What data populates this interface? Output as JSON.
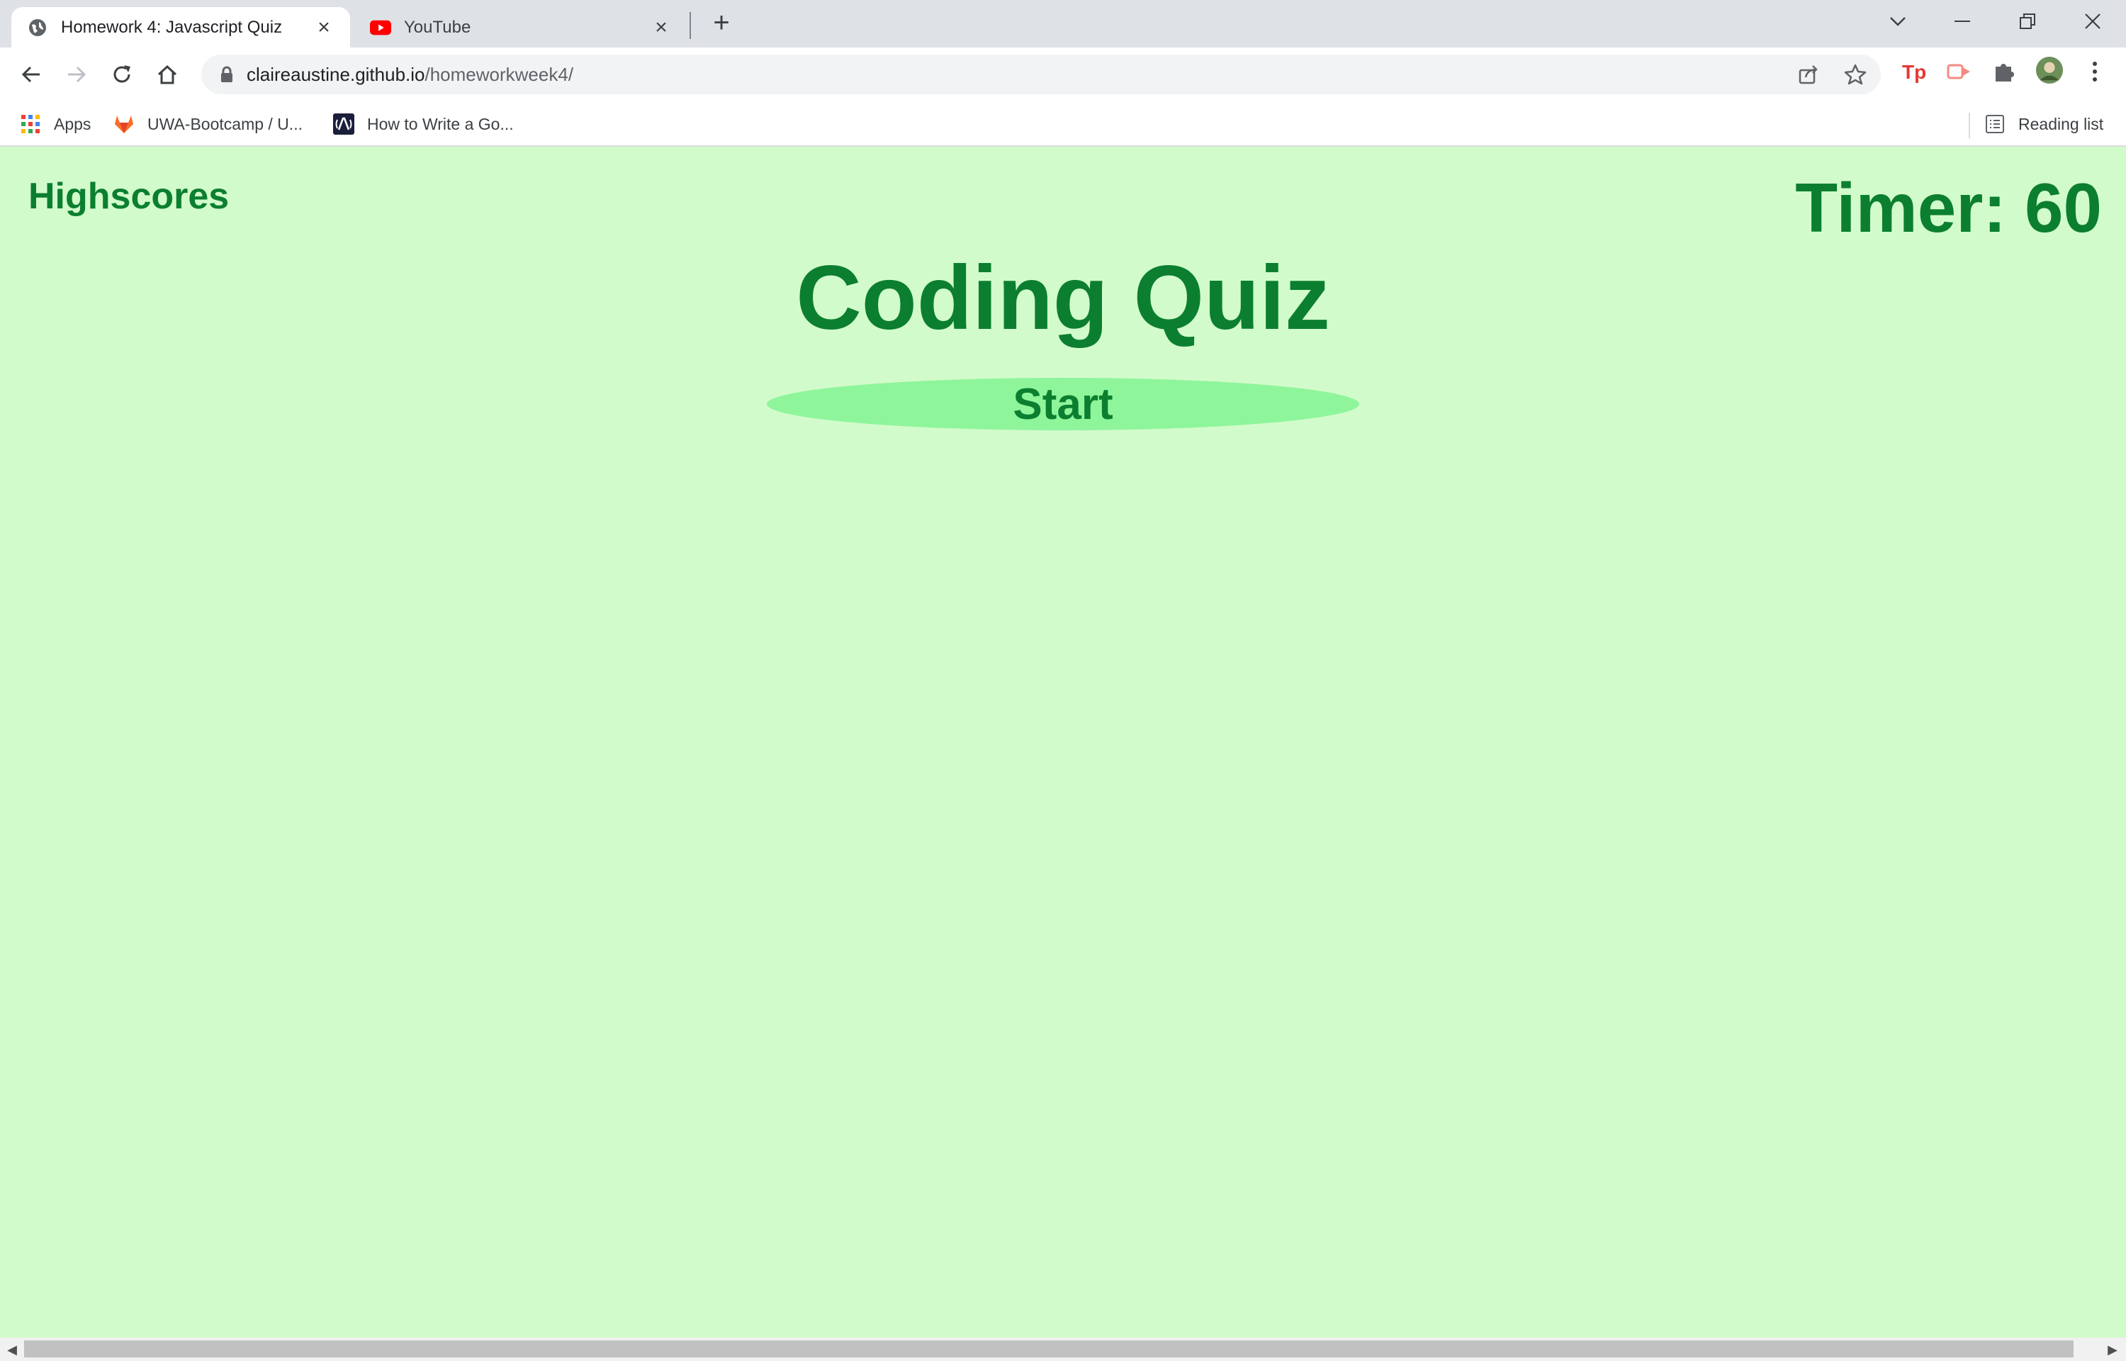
{
  "browser": {
    "tabs": [
      {
        "title": "Homework 4: Javascript Quiz",
        "icon": "globe-icon",
        "active": true
      },
      {
        "title": "YouTube",
        "icon": "youtube-icon",
        "active": false
      }
    ],
    "new_tab_symbol": "+",
    "address": {
      "host": "claireaustine.github.io",
      "path": "/homeworkweek4/"
    },
    "bookmarks": [
      {
        "label": "Apps",
        "icon": "apps-grid-icon"
      },
      {
        "label": "UWA-Bootcamp / U...",
        "icon": "gitlab-icon"
      },
      {
        "label": "How to Write a Go...",
        "icon": "site-icon"
      }
    ],
    "reading_list_label": "Reading list",
    "colors": {
      "brand_red": "#e53935",
      "accent": "#0b7f2f"
    }
  },
  "page": {
    "highscores_label": "Highscores",
    "timer_label": "Timer:",
    "timer_value": "60",
    "title": "Coding Quiz",
    "start_label": "Start",
    "colors": {
      "background": "#d2fbcb",
      "text": "#0b7f2f",
      "button": "#8ef59b"
    }
  }
}
